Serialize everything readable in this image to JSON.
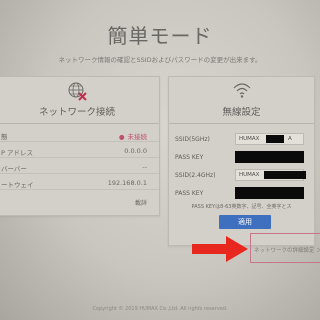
{
  "page": {
    "title": "簡単モード",
    "subtitle": "ネットワーク情報の確認とSSIDおよびパスワードの変更が出来ます。"
  },
  "network": {
    "title": "ネットワーク接続",
    "rows": [
      {
        "label": "態",
        "value": "未接続"
      },
      {
        "label": "P アドレス",
        "value": "0.0.0.0"
      },
      {
        "label": "バーバー",
        "value": "--"
      },
      {
        "label": "ートウェイ",
        "value": "192.168.0.1"
      }
    ],
    "detail_label": "載詳"
  },
  "wireless": {
    "title": "無線設定",
    "ssid5_label": "SSID(5GHz)",
    "ssid5_value": "HUMAX",
    "ssid5_suffix": "A",
    "passkey1_label": "PASS KEY",
    "ssid24_label": "SSID(2.4GHz)",
    "ssid24_value": "HUMAX",
    "passkey2_label": "PASS KEY",
    "note": "PASS KEYは8-63英数字、記号、全英字とス",
    "apply_label": "適用"
  },
  "advanced_link": "ネットワークの詳細設定 ＞",
  "footer": "Copyright © 2019 HUMAX Co.,Ltd. All rights reserved.",
  "colors": {
    "accent_blue": "#3f6fbf",
    "arrow_red": "#e8281e",
    "status_pink": "#c0506a"
  },
  "icons": {
    "network": "globe-with-x-icon",
    "wireless": "wifi-icon",
    "pointer": "red-arrow-icon"
  }
}
